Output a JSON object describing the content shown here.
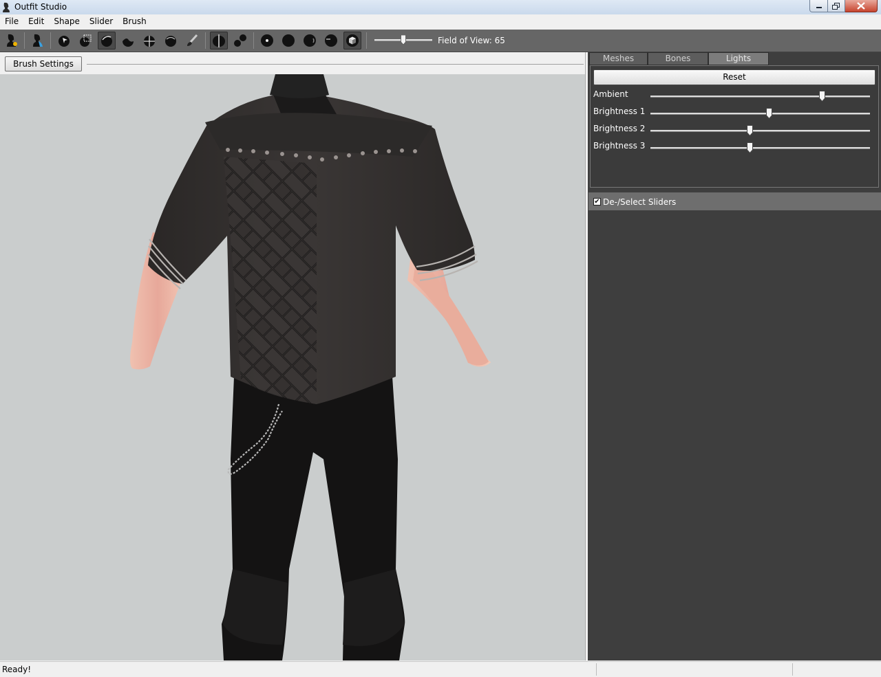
{
  "window": {
    "title": "Outfit Studio",
    "app_icon": "outfit-studio-bust-icon"
  },
  "menu": [
    {
      "label": "File"
    },
    {
      "label": "Edit"
    },
    {
      "label": "Shape"
    },
    {
      "label": "Slider"
    },
    {
      "label": "Brush"
    }
  ],
  "toolbar": {
    "fov_label": "Field of View: 65",
    "fov_value": 65,
    "colors": {
      "background": "#666666",
      "icon": "#111111",
      "active_bg": "#4a4a4a"
    }
  },
  "left": {
    "brush_settings_label": "Brush Settings >>"
  },
  "right": {
    "tabs": [
      {
        "label": "Meshes",
        "active": false
      },
      {
        "label": "Bones",
        "active": false
      },
      {
        "label": "Lights",
        "active": true
      }
    ],
    "lights": {
      "reset_label": "Reset",
      "sliders": [
        {
          "label": "Ambient",
          "value": 0.78
        },
        {
          "label": "Brightness 1",
          "value": 0.54
        },
        {
          "label": "Brightness 2",
          "value": 0.45
        },
        {
          "label": "Brightness 3",
          "value": 0.45
        }
      ]
    },
    "deselect_sliders_label": "De-/Select Sliders",
    "deselect_sliders_checked": true
  },
  "status": {
    "text": "Ready!"
  }
}
